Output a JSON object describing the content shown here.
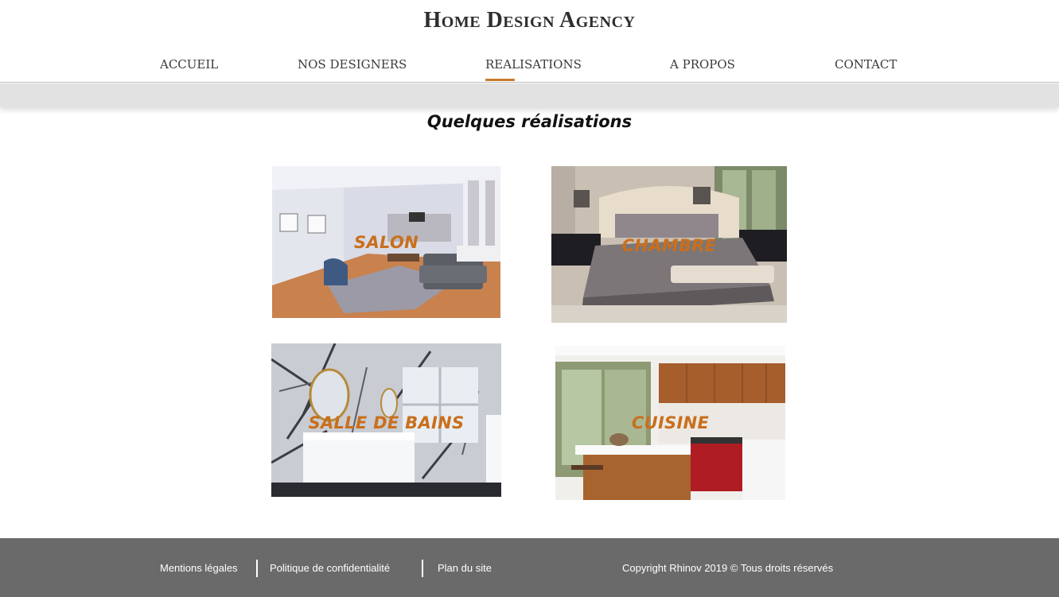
{
  "header": {
    "title": "Home Design Agency"
  },
  "nav": {
    "items": [
      {
        "label": "ACCUEIL"
      },
      {
        "label": "NOS DESIGNERS"
      },
      {
        "label": "REALISATIONS"
      },
      {
        "label": "A PROPOS"
      },
      {
        "label": "CONTACT"
      }
    ],
    "active_index": 2
  },
  "main": {
    "heading": "Quelques réalisations",
    "gallery": [
      {
        "label": "SALON",
        "image": "living-room-photo"
      },
      {
        "label": "CHAMBRE",
        "image": "bedroom-photo"
      },
      {
        "label": "SALLE DE BAINS",
        "image": "bathroom-photo"
      },
      {
        "label": "CUISINE",
        "image": "kitchen-photo"
      }
    ]
  },
  "footer": {
    "links": [
      {
        "label": "Mentions légales"
      },
      {
        "label": "Politique de confidentialité"
      },
      {
        "label": "Plan du site"
      }
    ],
    "copyright": "Copyright Rhinov 2019 © Tous droits réservés"
  },
  "colors": {
    "accent": "#c96f1c",
    "footer_bg": "#6a6a6a",
    "band_bg": "#e2e2e2"
  }
}
